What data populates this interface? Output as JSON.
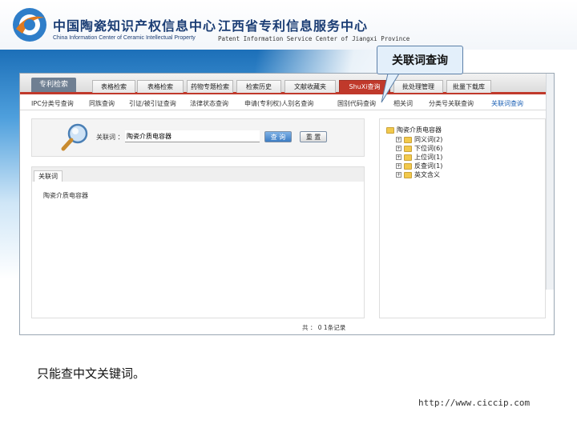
{
  "header": {
    "title_cn_left": "中国陶瓷知识产权信息中心",
    "title_en_left": "China Information Center of Ceramic Intellectual Property",
    "title_cn_right": "江西省专利信息服务中心",
    "title_en_right": "Patent Information Service Center of  Jiangxi  Province"
  },
  "callout": {
    "text": "关联词查询"
  },
  "nav": {
    "brand": "专利检索",
    "tabs": [
      "表格检索",
      "表格检索",
      "药物专题检索",
      "检索历史",
      "文献收藏夹",
      "ShuXi查询",
      "批处理管理",
      "批量下载库"
    ],
    "active_tab_index": 5
  },
  "subnav": {
    "items": [
      "IPC分类号查询",
      "同族查询",
      "引证/被引证查询",
      "法律状态查询",
      "申请(专利权)人别名查询",
      "国别代码查询",
      "相关词",
      "分类号关联查询",
      "关联词查询"
    ],
    "active_index": 8
  },
  "search": {
    "label": "关联词 ：",
    "value": "陶瓷介质电容器",
    "query_button": "查 询",
    "reset_button": "重 置"
  },
  "results": {
    "tab_label": "关联词",
    "items": [
      "陶瓷介质电容器"
    ],
    "pager": "共 ： 0 1条记录"
  },
  "tree": {
    "root": "陶瓷介质电容器",
    "children": [
      "同义词(2)",
      "下位词(6)",
      "上位词(1)",
      "反查词(1)",
      "英文含义"
    ]
  },
  "footer": {
    "note": "只能查中文关键词。",
    "url": "http://www.ciccip.com"
  },
  "colors": {
    "accent_red": "#c0392b",
    "brand_blue": "#1b3d74",
    "link_blue": "#1a5fb4"
  }
}
